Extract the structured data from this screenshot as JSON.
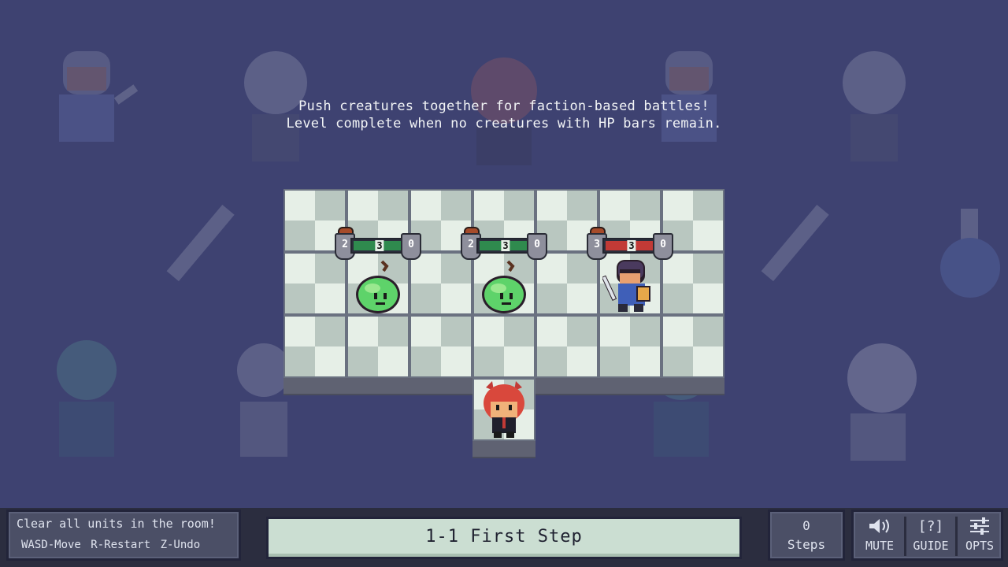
{
  "instructions": {
    "line1": "Push creatures together for faction-based battles!",
    "line2": "Level complete when no creatures with HP bars remain."
  },
  "units": [
    {
      "type": "slime",
      "faction": "green",
      "atk": "2",
      "hp": "3",
      "def": "0",
      "hp_color": "#2f8a4e"
    },
    {
      "type": "slime",
      "faction": "green",
      "atk": "2",
      "hp": "3",
      "def": "0",
      "hp_color": "#2f8a4e"
    },
    {
      "type": "knight",
      "faction": "red",
      "atk": "3",
      "hp": "3",
      "def": "0",
      "hp_color": "#c23a36"
    }
  ],
  "player": {
    "type": "demon-girl"
  },
  "hint": {
    "title": "Clear all units in the room!",
    "keys": "WASD-Move  R-Restart  Z-Undo"
  },
  "level": {
    "title": "1-1 First Step"
  },
  "steps": {
    "count": "0",
    "label": "Steps"
  },
  "buttons": [
    {
      "icon": "speaker-icon",
      "label": "MUTE"
    },
    {
      "icon": "help-icon",
      "glyph": "[?]",
      "label": "GUIDE"
    },
    {
      "icon": "sliders-icon",
      "label": "OPTS"
    }
  ],
  "colors": {
    "background": "#3e4271",
    "tile_light": "#e6efe7",
    "tile_dark": "#b9c7c0",
    "level_bar": "#cbded2",
    "panel": "#4b4f66"
  }
}
